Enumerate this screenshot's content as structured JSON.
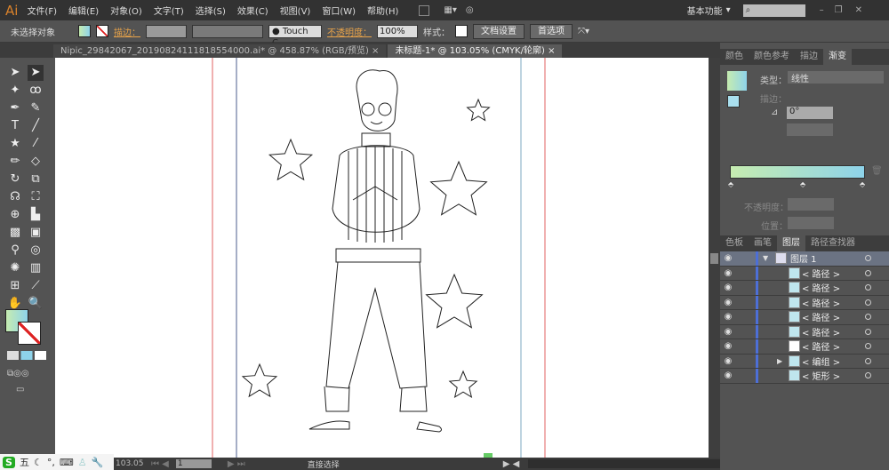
{
  "app": {
    "logo": "Ai"
  },
  "menu": [
    "文件(F)",
    "编辑(E)",
    "对象(O)",
    "文字(T)",
    "选择(S)",
    "效果(C)",
    "视图(V)",
    "窗口(W)",
    "帮助(H)"
  ],
  "workspace": "基本功能",
  "control": {
    "selection": "未选择对象",
    "stroke_label": "描边：",
    "brush": "Touch C...",
    "opacity_label": "不透明度：",
    "opacity": "100%",
    "style_label": "样式：",
    "doc_setup": "文档设置",
    "prefs": "首选项"
  },
  "tabs": [
    {
      "label": "Nipic_29842067_20190824111818554000.ai* @ 458.87% (RGB/预览)"
    },
    {
      "label": "未标题-1* @ 103.05% (CMYK/轮廓)"
    }
  ],
  "gradient_panel": {
    "tabs": [
      "颜色",
      "颜色参考",
      "描边",
      "渐变"
    ],
    "type_label": "类型：",
    "type": "线性",
    "stroke_label": "描边：",
    "angle": "0°",
    "opacity_label": "不透明度：",
    "position_label": "位置：",
    "colors": [
      "#c6ecb0",
      "#8ed3ea"
    ]
  },
  "layers_panel": {
    "tabs": [
      "色板",
      "画笔",
      "图层",
      "路径查找器"
    ],
    "layer": "图层 1",
    "items": [
      "< 路径 >",
      "< 路径 >",
      "< 路径 >",
      "< 路径 >",
      "< 路径 >",
      "< 路径 >",
      "< 编组 >",
      "< 矩形 >"
    ]
  },
  "status": {
    "zoom": "103.05",
    "page": "1",
    "tool": "直接选择"
  },
  "ime": {
    "mode": "五"
  }
}
